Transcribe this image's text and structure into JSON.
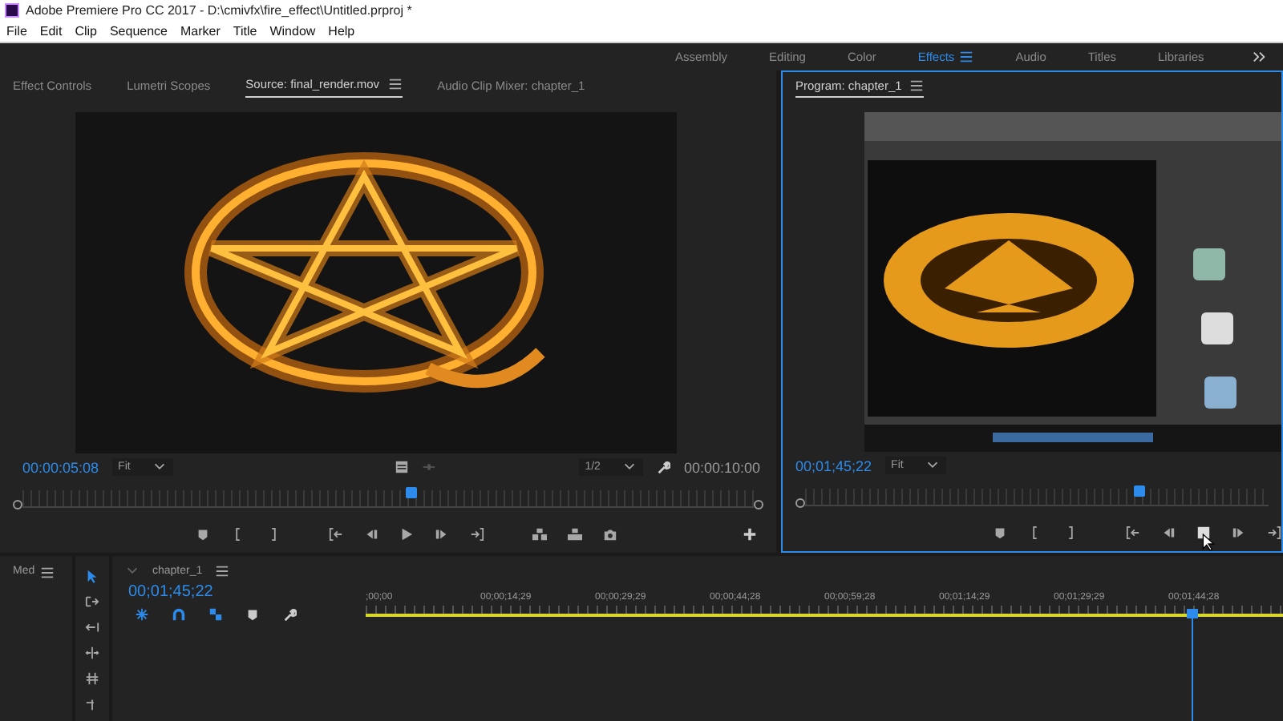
{
  "window": {
    "title": "Adobe Premiere Pro CC 2017 - D:\\cmivfx\\fire_effect\\Untitled.prproj *"
  },
  "menu": [
    "File",
    "Edit",
    "Clip",
    "Sequence",
    "Marker",
    "Title",
    "Window",
    "Help"
  ],
  "workspaces": [
    {
      "label": "Assembly",
      "selected": false
    },
    {
      "label": "Editing",
      "selected": false
    },
    {
      "label": "Color",
      "selected": false
    },
    {
      "label": "Effects",
      "selected": true
    },
    {
      "label": "Audio",
      "selected": false
    },
    {
      "label": "Titles",
      "selected": false
    },
    {
      "label": "Libraries",
      "selected": false
    }
  ],
  "source_panel": {
    "tabs": [
      {
        "label": "Effect Controls",
        "selected": false
      },
      {
        "label": "Lumetri Scopes",
        "selected": false
      },
      {
        "label": "Source: final_render.mov",
        "selected": true
      },
      {
        "label": "Audio Clip Mixer: chapter_1",
        "selected": false
      }
    ],
    "timecode": "00:00:05:08",
    "zoom": "Fit",
    "resolution": "1/2",
    "duration": "00:00:10:00",
    "playhead": {
      "level": 0.53
    }
  },
  "program_panel": {
    "tabs": [
      {
        "label": "Program: chapter_1",
        "selected": true
      }
    ],
    "timecode": "00;01;45;22",
    "zoom": "Fit",
    "playhead": {
      "level": 0.72
    }
  },
  "project_panel": {
    "tab": "Med"
  },
  "timeline": {
    "tab": "chapter_1",
    "timecode": "00;01;45;22",
    "ruler": [
      ";00;00",
      "00;00;14;29",
      "00;00;29;29",
      "00;00;44;28",
      "00;00;59;28",
      "00;01;14;29",
      "00;01;29;29",
      "00;01;44;28"
    ],
    "playhead": {
      "level": 0.9
    }
  }
}
